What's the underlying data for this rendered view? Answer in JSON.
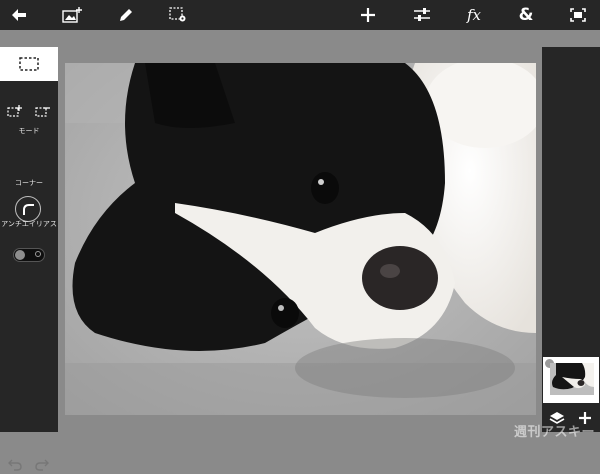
{
  "colors": {
    "toolbar_bg": "#262626",
    "panel_bg": "#262626",
    "workspace_bg": "#8a8a8a",
    "icon": "#ffffff",
    "selected_tool_bg": "#ffffff"
  },
  "toolbar": {
    "left": [
      {
        "icon": "back-arrow-icon"
      },
      {
        "icon": "add-image-icon"
      },
      {
        "icon": "brush-icon"
      },
      {
        "icon": "selection-settings-icon"
      }
    ],
    "right": [
      {
        "icon": "plus-icon"
      },
      {
        "icon": "adjustments-icon"
      },
      {
        "icon": "fx-icon",
        "label": "fx"
      },
      {
        "icon": "ampersand-icon",
        "label": "&"
      },
      {
        "icon": "fit-screen-icon"
      }
    ]
  },
  "left_panel": {
    "selected_tool_icon": "rect-marquee-icon",
    "mode_label": "モード",
    "corner_label": "コーナー",
    "antialias_label": "アンチエイリアス",
    "antialias_on": false,
    "undo_icon": "undo-icon",
    "redo_icon": "redo-icon"
  },
  "canvas": {
    "subject": "photo"
  },
  "right_panel": {
    "layers_icon": "layers-icon",
    "add_layer_icon": "plus-icon"
  },
  "watermark": {
    "text": "週刊アスキー"
  }
}
